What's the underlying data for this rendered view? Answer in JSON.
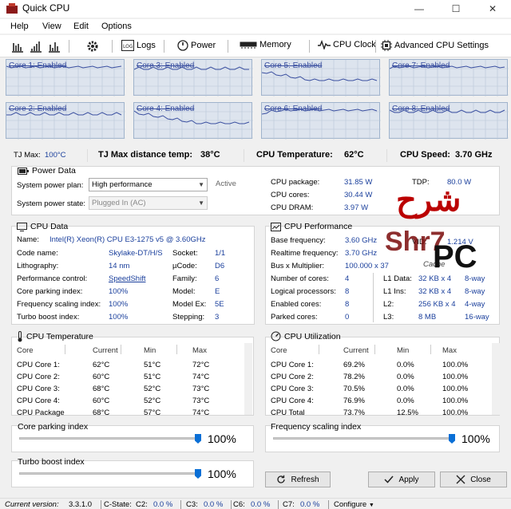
{
  "window": {
    "title": "Quick CPU",
    "controls": [
      "—",
      "☐",
      "✕"
    ]
  },
  "menu": [
    "Help",
    "View",
    "Edit",
    "Options"
  ],
  "toolbar": {
    "logs": "Logs",
    "power": "Power",
    "memory": "Memory",
    "cpu_clock": "CPU Clock",
    "advanced": "Advanced CPU Settings"
  },
  "cores": [
    {
      "label": "Core 1: Enabled"
    },
    {
      "label": "Core 3: Enabled"
    },
    {
      "label": "Core 5: Enabled"
    },
    {
      "label": "Core 7: Enabled"
    },
    {
      "label": "Core 2: Enabled"
    },
    {
      "label": "Core 4: Enabled"
    },
    {
      "label": "Core 6: Enabled"
    },
    {
      "label": "Core 8: Enabled"
    }
  ],
  "temps": {
    "tjmax_label": "TJ Max:",
    "tjmax_value": "100°C",
    "tjdist_label": "TJ Max distance temp:",
    "tjdist_value": "38°C",
    "cputemp_label": "CPU Temperature:",
    "cputemp_value": "62°C",
    "speed_label": "CPU Speed:",
    "speed_value": "3.70 GHz"
  },
  "power_data": {
    "title": "Power Data",
    "plan_label": "System power plan:",
    "plan_value": "High performance",
    "plan_status": "Active",
    "state_label": "System power state:",
    "state_value": "Plugged In (AC)",
    "rows": [
      {
        "label": "CPU package:",
        "value": "31.85 W"
      },
      {
        "label": "CPU cores:",
        "value": "30.44 W"
      },
      {
        "label": "CPU DRAM:",
        "value": "3.97 W"
      }
    ],
    "tdp_label": "TDP:",
    "tdp_value": "80.0 W"
  },
  "cpu_data": {
    "title": "CPU Data",
    "name_label": "Name:",
    "name_value": "Intel(R) Xeon(R) CPU E3-1275 v5 @ 3.60GHz",
    "left": [
      {
        "label": "Code name:",
        "value": "Skylake-DT/H/S"
      },
      {
        "label": "Lithography:",
        "value": "14 nm"
      },
      {
        "label": "Performance control:",
        "value": "SpeedShift"
      },
      {
        "label": "Core parking index:",
        "value": "100%"
      },
      {
        "label": "Frequency scaling index:",
        "value": "100%"
      },
      {
        "label": "Turbo boost index:",
        "value": "100%"
      }
    ],
    "right": [
      {
        "label": "Socket:",
        "value": "1/1"
      },
      {
        "label": "µCode:",
        "value": "D6"
      },
      {
        "label": "Family:",
        "value": "6"
      },
      {
        "label": "Model:",
        "value": "E"
      },
      {
        "label": "Model Ex:",
        "value": "5E"
      },
      {
        "label": "Stepping:",
        "value": "3"
      }
    ]
  },
  "cpu_perf": {
    "title": "CPU Performance",
    "rows": [
      {
        "label": "Base frequency:",
        "value": "3.60 GHz"
      },
      {
        "label": "Realtime frequency:",
        "value": "3.70 GHz"
      },
      {
        "label": "Bus x Multiplier:",
        "value": "100.000 x 37"
      }
    ],
    "vid_label": "VID:",
    "vid_value": "1.214 V",
    "cache_label": "Cache",
    "counts": [
      {
        "label": "Number of cores:",
        "value": "4"
      },
      {
        "label": "Logical processors:",
        "value": "8"
      },
      {
        "label": "Enabled cores:",
        "value": "8"
      },
      {
        "label": "Parked cores:",
        "value": "0"
      }
    ],
    "cache": [
      {
        "label": "L1 Data:",
        "size": "32 KB x 4",
        "way": "8-way"
      },
      {
        "label": "L1 Ins:",
        "size": "32 KB x 4",
        "way": "8-way"
      },
      {
        "label": "L2:",
        "size": "256 KB x 4",
        "way": "4-way"
      },
      {
        "label": "L3:",
        "size": "8 MB",
        "way": "16-way"
      }
    ]
  },
  "cpu_temp": {
    "title": "CPU Temperature",
    "headers": [
      "Core",
      "Current",
      "Min",
      "Max"
    ],
    "rows": [
      [
        "CPU Core 1:",
        "62°C",
        "51°C",
        "72°C"
      ],
      [
        "CPU Core 2:",
        "60°C",
        "51°C",
        "74°C"
      ],
      [
        "CPU Core 3:",
        "68°C",
        "52°C",
        "73°C"
      ],
      [
        "CPU Core 4:",
        "60°C",
        "52°C",
        "73°C"
      ],
      [
        "CPU Package",
        "68°C",
        "57°C",
        "74°C"
      ]
    ]
  },
  "cpu_util": {
    "title": "CPU Utilization",
    "headers": [
      "Core",
      "Current",
      "Min",
      "Max"
    ],
    "rows": [
      [
        "CPU Core 1:",
        "69.2%",
        "0.0%",
        "100.0%"
      ],
      [
        "CPU Core 2:",
        "78.2%",
        "0.0%",
        "100.0%"
      ],
      [
        "CPU Core 3:",
        "70.5%",
        "0.0%",
        "100.0%"
      ],
      [
        "CPU Core 4:",
        "76.9%",
        "0.0%",
        "100.0%"
      ],
      [
        "CPU Total",
        "73.7%",
        "12.5%",
        "100.0%"
      ]
    ]
  },
  "sliders": {
    "core_parking": {
      "label": "Core parking index",
      "value": "100%",
      "level": 1.0
    },
    "freq_scaling": {
      "label": "Frequency scaling index",
      "value": "100%",
      "level": 1.0
    },
    "turbo_boost": {
      "label": "Turbo boost index",
      "value": "100%",
      "level": 1.0
    }
  },
  "buttons": {
    "refresh": "Refresh",
    "apply": "Apply",
    "close": "Close"
  },
  "status": {
    "version_label": "Current version:",
    "version_value": "3.3.1.0",
    "cstate_label": "C-State:",
    "items": [
      {
        "label": "C2:",
        "value": "0.0 %"
      },
      {
        "label": "C3:",
        "value": "0.0 %"
      },
      {
        "label": "C6:",
        "value": "0.0 %"
      },
      {
        "label": "C7:",
        "value": "0.0 %"
      }
    ],
    "configure": "Configure"
  },
  "watermark": {
    "arabic": "شرح",
    "latin": "Shr7",
    "pc": "PC"
  },
  "colors": {
    "value_blue": "#1a3f9c",
    "graph_bg": "#dde4ee",
    "graph_line": "#3a4fa0",
    "slider_thumb": "#0a6fd6"
  }
}
